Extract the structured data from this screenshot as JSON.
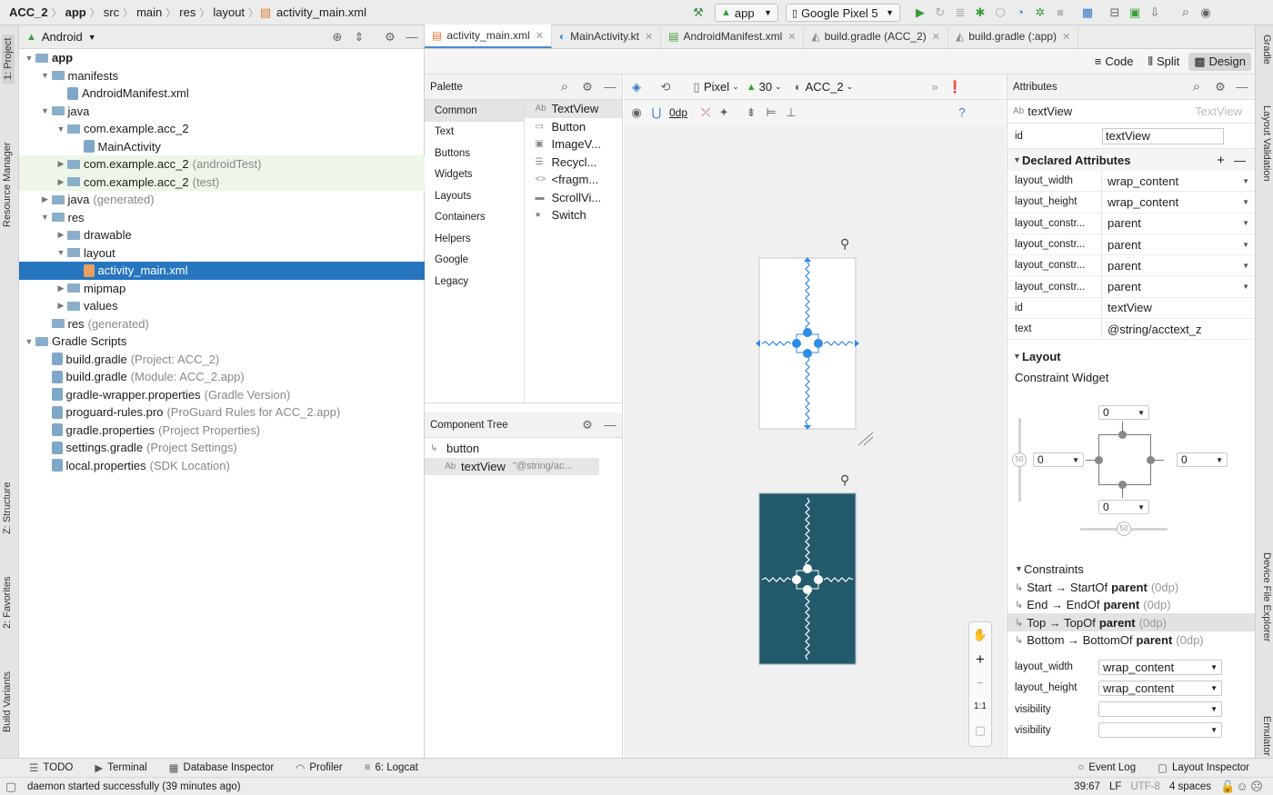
{
  "breadcrumb": [
    "ACC_2",
    "app",
    "src",
    "main",
    "res",
    "layout",
    "activity_main.xml"
  ],
  "toolbar": {
    "run_config": "app",
    "device": "Google Pixel 5"
  },
  "left_tabs": [
    "1: Project",
    "Resource Manager",
    "Z: Structure",
    "2: Favorites",
    "Build Variants"
  ],
  "right_tabs": [
    "Gradle",
    "Layout Validation",
    "Device File Explorer",
    "Emulator"
  ],
  "project": {
    "view_mode": "Android",
    "tree": [
      {
        "label": "app",
        "depth": 0,
        "expanded": true,
        "bold": true
      },
      {
        "label": "manifests",
        "depth": 1,
        "expanded": true
      },
      {
        "label": "AndroidManifest.xml",
        "depth": 2,
        "file": true
      },
      {
        "label": "java",
        "depth": 1,
        "expanded": true
      },
      {
        "label": "com.example.acc_2",
        "depth": 2,
        "expanded": true
      },
      {
        "label": "MainActivity",
        "depth": 3,
        "file": true
      },
      {
        "label": "com.example.acc_2",
        "suffix": "(androidTest)",
        "depth": 2,
        "collapsed": true,
        "green": true
      },
      {
        "label": "com.example.acc_2",
        "suffix": "(test)",
        "depth": 2,
        "collapsed": true,
        "green": true
      },
      {
        "label": "java",
        "suffix": "(generated)",
        "depth": 1,
        "collapsed": true
      },
      {
        "label": "res",
        "depth": 1,
        "expanded": true
      },
      {
        "label": "drawable",
        "depth": 2,
        "collapsed": true
      },
      {
        "label": "layout",
        "depth": 2,
        "expanded": true
      },
      {
        "label": "activity_main.xml",
        "depth": 3,
        "file": true,
        "selected": true
      },
      {
        "label": "mipmap",
        "depth": 2,
        "collapsed": true
      },
      {
        "label": "values",
        "depth": 2,
        "collapsed": true
      },
      {
        "label": "res",
        "suffix": "(generated)",
        "depth": 1
      },
      {
        "label": "Gradle Scripts",
        "depth": 0,
        "expanded": true
      },
      {
        "label": "build.gradle",
        "suffix": "(Project: ACC_2)",
        "depth": 1,
        "file": true
      },
      {
        "label": "build.gradle",
        "suffix": "(Module: ACC_2.app)",
        "depth": 1,
        "file": true
      },
      {
        "label": "gradle-wrapper.properties",
        "suffix": "(Gradle Version)",
        "depth": 1,
        "file": true
      },
      {
        "label": "proguard-rules.pro",
        "suffix": "(ProGuard Rules for ACC_2.app)",
        "depth": 1,
        "file": true
      },
      {
        "label": "gradle.properties",
        "suffix": "(Project Properties)",
        "depth": 1,
        "file": true
      },
      {
        "label": "settings.gradle",
        "suffix": "(Project Settings)",
        "depth": 1,
        "file": true
      },
      {
        "label": "local.properties",
        "suffix": "(SDK Location)",
        "depth": 1,
        "file": true
      }
    ]
  },
  "tabs": [
    "activity_main.xml",
    "MainActivity.kt",
    "AndroidManifest.xml",
    "build.gradle (ACC_2)",
    "build.gradle (:app)"
  ],
  "view_modes": {
    "code": "Code",
    "split": "Split",
    "design": "Design"
  },
  "palette": {
    "title": "Palette",
    "categories": [
      "Common",
      "Text",
      "Buttons",
      "Widgets",
      "Layouts",
      "Containers",
      "Helpers",
      "Google",
      "Legacy"
    ],
    "items": [
      {
        "icon": "Ab",
        "label": "TextView"
      },
      {
        "icon": "▭",
        "label": "Button"
      },
      {
        "icon": "▣",
        "label": "ImageV..."
      },
      {
        "icon": "☰",
        "label": "Recycl..."
      },
      {
        "icon": "<>",
        "label": "<fragm..."
      },
      {
        "icon": "▬",
        "label": "ScrollVi..."
      },
      {
        "icon": "●",
        "label": "Switch"
      }
    ]
  },
  "component_tree": {
    "title": "Component Tree",
    "items": [
      {
        "label": "button",
        "depth": 0
      },
      {
        "label": "textView",
        "hint": "\"@string/ac...",
        "depth": 1,
        "selected": true
      }
    ]
  },
  "design_toolbar": {
    "device": "Pixel",
    "api": "30",
    "theme": "ACC_2",
    "margin": "0dp"
  },
  "zoom": {
    "plus": "+",
    "minus": "−",
    "ratio": "1:1"
  },
  "attributes": {
    "title": "Attributes",
    "component": "textView",
    "component_type": "TextView",
    "id_label": "id",
    "id_value": "textView",
    "declared_title": "Declared Attributes",
    "declared": [
      {
        "name": "layout_width",
        "value": "wrap_content"
      },
      {
        "name": "layout_height",
        "value": "wrap_content"
      },
      {
        "name": "layout_constr...",
        "value": "parent"
      },
      {
        "name": "layout_constr...",
        "value": "parent"
      },
      {
        "name": "layout_constr...",
        "value": "parent"
      },
      {
        "name": "layout_constr...",
        "value": "parent"
      },
      {
        "name": "id",
        "value": "textView"
      },
      {
        "name": "text",
        "value": "@string/acctext_z"
      }
    ],
    "layout_title": "Layout",
    "constraint_widget": "Constraint Widget",
    "margins": {
      "top": "0",
      "left": "0",
      "right": "0",
      "bottom": "0",
      "bias_v": "50",
      "bias_h": "50"
    },
    "constraints_title": "Constraints",
    "constraints": [
      {
        "label": "Start → StartOf",
        "target": "parent",
        "margin": "(0dp)"
      },
      {
        "label": "End → EndOf",
        "target": "parent",
        "margin": "(0dp)"
      },
      {
        "label": "Top → TopOf",
        "target": "parent",
        "margin": "(0dp)",
        "selected": true
      },
      {
        "label": "Bottom → BottomOf",
        "target": "parent",
        "margin": "(0dp)"
      }
    ],
    "layout_attrs": [
      {
        "name": "layout_width",
        "value": "wrap_content"
      },
      {
        "name": "layout_height",
        "value": "wrap_content"
      },
      {
        "name": "visibility",
        "value": ""
      },
      {
        "name": "visibility",
        "value": ""
      }
    ]
  },
  "bottom_tools": [
    {
      "icon": "☰",
      "label": "TODO"
    },
    {
      "icon": "▶",
      "label": "Terminal"
    },
    {
      "icon": "▦",
      "label": "Database Inspector"
    },
    {
      "icon": "◠",
      "label": "Profiler"
    },
    {
      "icon": "≡",
      "label": "6: Logcat"
    }
  ],
  "bottom_tools_right": [
    {
      "icon": "○",
      "label": "Event Log"
    },
    {
      "icon": "▢",
      "label": "Layout Inspector"
    }
  ],
  "status": {
    "message": "daemon started successfully (39 minutes ago)",
    "position": "39:67",
    "line_sep": "LF",
    "encoding": "UTF-8",
    "indent": "4 spaces"
  },
  "colors": {
    "accent": "#2675bf",
    "blueprint": "#235a6b",
    "constraint": "#2f8be6"
  }
}
